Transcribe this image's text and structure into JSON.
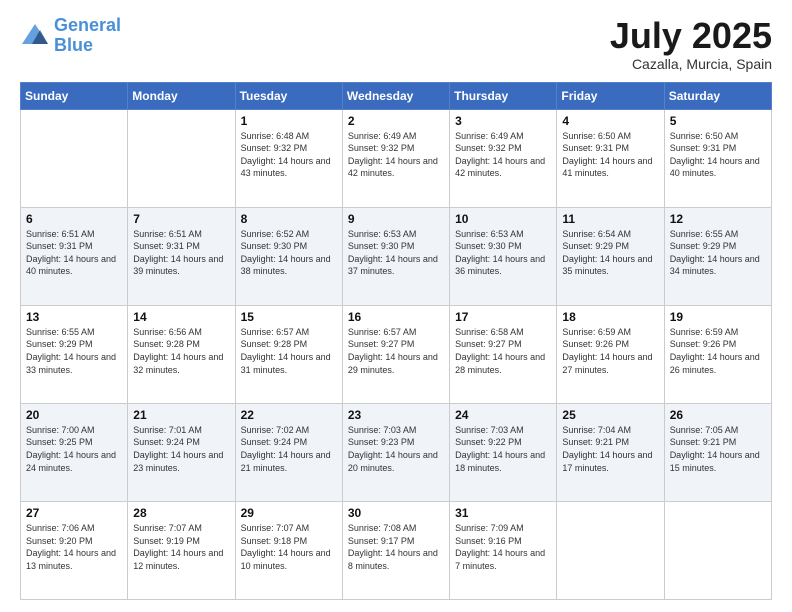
{
  "header": {
    "logo_line1": "General",
    "logo_line2": "Blue",
    "month_title": "July 2025",
    "location": "Cazalla, Murcia, Spain"
  },
  "weekdays": [
    "Sunday",
    "Monday",
    "Tuesday",
    "Wednesday",
    "Thursday",
    "Friday",
    "Saturday"
  ],
  "weeks": [
    [
      {
        "day": "",
        "sunrise": "",
        "sunset": "",
        "daylight": ""
      },
      {
        "day": "",
        "sunrise": "",
        "sunset": "",
        "daylight": ""
      },
      {
        "day": "1",
        "sunrise": "Sunrise: 6:48 AM",
        "sunset": "Sunset: 9:32 PM",
        "daylight": "Daylight: 14 hours and 43 minutes."
      },
      {
        "day": "2",
        "sunrise": "Sunrise: 6:49 AM",
        "sunset": "Sunset: 9:32 PM",
        "daylight": "Daylight: 14 hours and 42 minutes."
      },
      {
        "day": "3",
        "sunrise": "Sunrise: 6:49 AM",
        "sunset": "Sunset: 9:32 PM",
        "daylight": "Daylight: 14 hours and 42 minutes."
      },
      {
        "day": "4",
        "sunrise": "Sunrise: 6:50 AM",
        "sunset": "Sunset: 9:31 PM",
        "daylight": "Daylight: 14 hours and 41 minutes."
      },
      {
        "day": "5",
        "sunrise": "Sunrise: 6:50 AM",
        "sunset": "Sunset: 9:31 PM",
        "daylight": "Daylight: 14 hours and 40 minutes."
      }
    ],
    [
      {
        "day": "6",
        "sunrise": "Sunrise: 6:51 AM",
        "sunset": "Sunset: 9:31 PM",
        "daylight": "Daylight: 14 hours and 40 minutes."
      },
      {
        "day": "7",
        "sunrise": "Sunrise: 6:51 AM",
        "sunset": "Sunset: 9:31 PM",
        "daylight": "Daylight: 14 hours and 39 minutes."
      },
      {
        "day": "8",
        "sunrise": "Sunrise: 6:52 AM",
        "sunset": "Sunset: 9:30 PM",
        "daylight": "Daylight: 14 hours and 38 minutes."
      },
      {
        "day": "9",
        "sunrise": "Sunrise: 6:53 AM",
        "sunset": "Sunset: 9:30 PM",
        "daylight": "Daylight: 14 hours and 37 minutes."
      },
      {
        "day": "10",
        "sunrise": "Sunrise: 6:53 AM",
        "sunset": "Sunset: 9:30 PM",
        "daylight": "Daylight: 14 hours and 36 minutes."
      },
      {
        "day": "11",
        "sunrise": "Sunrise: 6:54 AM",
        "sunset": "Sunset: 9:29 PM",
        "daylight": "Daylight: 14 hours and 35 minutes."
      },
      {
        "day": "12",
        "sunrise": "Sunrise: 6:55 AM",
        "sunset": "Sunset: 9:29 PM",
        "daylight": "Daylight: 14 hours and 34 minutes."
      }
    ],
    [
      {
        "day": "13",
        "sunrise": "Sunrise: 6:55 AM",
        "sunset": "Sunset: 9:29 PM",
        "daylight": "Daylight: 14 hours and 33 minutes."
      },
      {
        "day": "14",
        "sunrise": "Sunrise: 6:56 AM",
        "sunset": "Sunset: 9:28 PM",
        "daylight": "Daylight: 14 hours and 32 minutes."
      },
      {
        "day": "15",
        "sunrise": "Sunrise: 6:57 AM",
        "sunset": "Sunset: 9:28 PM",
        "daylight": "Daylight: 14 hours and 31 minutes."
      },
      {
        "day": "16",
        "sunrise": "Sunrise: 6:57 AM",
        "sunset": "Sunset: 9:27 PM",
        "daylight": "Daylight: 14 hours and 29 minutes."
      },
      {
        "day": "17",
        "sunrise": "Sunrise: 6:58 AM",
        "sunset": "Sunset: 9:27 PM",
        "daylight": "Daylight: 14 hours and 28 minutes."
      },
      {
        "day": "18",
        "sunrise": "Sunrise: 6:59 AM",
        "sunset": "Sunset: 9:26 PM",
        "daylight": "Daylight: 14 hours and 27 minutes."
      },
      {
        "day": "19",
        "sunrise": "Sunrise: 6:59 AM",
        "sunset": "Sunset: 9:26 PM",
        "daylight": "Daylight: 14 hours and 26 minutes."
      }
    ],
    [
      {
        "day": "20",
        "sunrise": "Sunrise: 7:00 AM",
        "sunset": "Sunset: 9:25 PM",
        "daylight": "Daylight: 14 hours and 24 minutes."
      },
      {
        "day": "21",
        "sunrise": "Sunrise: 7:01 AM",
        "sunset": "Sunset: 9:24 PM",
        "daylight": "Daylight: 14 hours and 23 minutes."
      },
      {
        "day": "22",
        "sunrise": "Sunrise: 7:02 AM",
        "sunset": "Sunset: 9:24 PM",
        "daylight": "Daylight: 14 hours and 21 minutes."
      },
      {
        "day": "23",
        "sunrise": "Sunrise: 7:03 AM",
        "sunset": "Sunset: 9:23 PM",
        "daylight": "Daylight: 14 hours and 20 minutes."
      },
      {
        "day": "24",
        "sunrise": "Sunrise: 7:03 AM",
        "sunset": "Sunset: 9:22 PM",
        "daylight": "Daylight: 14 hours and 18 minutes."
      },
      {
        "day": "25",
        "sunrise": "Sunrise: 7:04 AM",
        "sunset": "Sunset: 9:21 PM",
        "daylight": "Daylight: 14 hours and 17 minutes."
      },
      {
        "day": "26",
        "sunrise": "Sunrise: 7:05 AM",
        "sunset": "Sunset: 9:21 PM",
        "daylight": "Daylight: 14 hours and 15 minutes."
      }
    ],
    [
      {
        "day": "27",
        "sunrise": "Sunrise: 7:06 AM",
        "sunset": "Sunset: 9:20 PM",
        "daylight": "Daylight: 14 hours and 13 minutes."
      },
      {
        "day": "28",
        "sunrise": "Sunrise: 7:07 AM",
        "sunset": "Sunset: 9:19 PM",
        "daylight": "Daylight: 14 hours and 12 minutes."
      },
      {
        "day": "29",
        "sunrise": "Sunrise: 7:07 AM",
        "sunset": "Sunset: 9:18 PM",
        "daylight": "Daylight: 14 hours and 10 minutes."
      },
      {
        "day": "30",
        "sunrise": "Sunrise: 7:08 AM",
        "sunset": "Sunset: 9:17 PM",
        "daylight": "Daylight: 14 hours and 8 minutes."
      },
      {
        "day": "31",
        "sunrise": "Sunrise: 7:09 AM",
        "sunset": "Sunset: 9:16 PM",
        "daylight": "Daylight: 14 hours and 7 minutes."
      },
      {
        "day": "",
        "sunrise": "",
        "sunset": "",
        "daylight": ""
      },
      {
        "day": "",
        "sunrise": "",
        "sunset": "",
        "daylight": ""
      }
    ]
  ]
}
